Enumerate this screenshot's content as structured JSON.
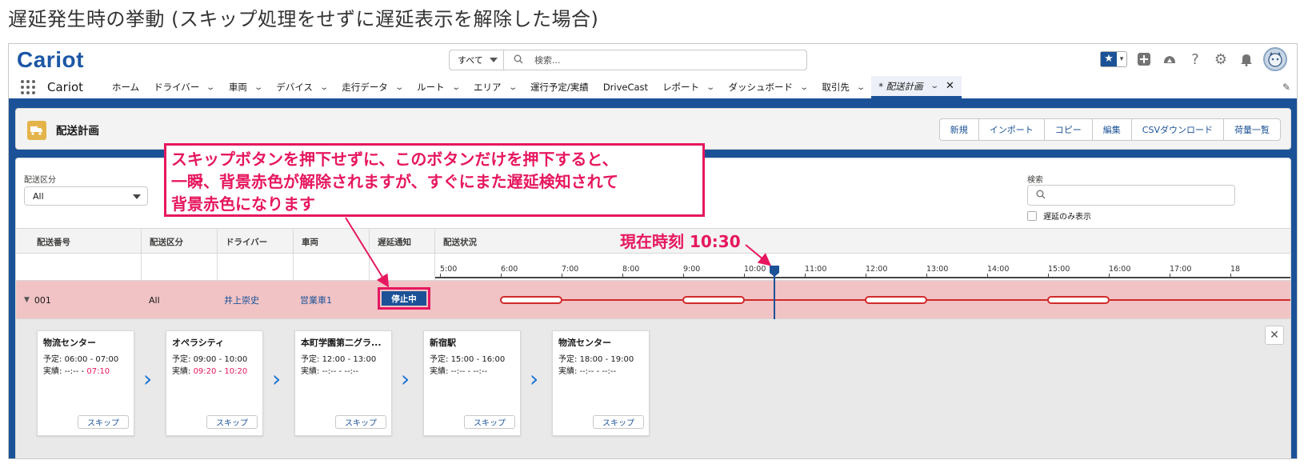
{
  "page_title": "遅延発生時の挙動 (スキップ処理をせずに遅延表示を解除した場合)",
  "header": {
    "logo": "Cariot",
    "search_scope": "すべて",
    "search_placeholder": "検索..."
  },
  "nav": {
    "app_name": "Cariot",
    "items": [
      {
        "label": "ホーム",
        "dropdown": false
      },
      {
        "label": "ドライバー",
        "dropdown": true
      },
      {
        "label": "車両",
        "dropdown": true
      },
      {
        "label": "デバイス",
        "dropdown": true
      },
      {
        "label": "走行データ",
        "dropdown": true
      },
      {
        "label": "ルート",
        "dropdown": true
      },
      {
        "label": "エリア",
        "dropdown": true
      },
      {
        "label": "運行予定/実績",
        "dropdown": false
      },
      {
        "label": "DriveCast",
        "dropdown": false
      },
      {
        "label": "レポート",
        "dropdown": true
      },
      {
        "label": "ダッシュボード",
        "dropdown": true
      },
      {
        "label": "取引先",
        "dropdown": true
      }
    ],
    "active_tab": "* 配送計画"
  },
  "object_header": {
    "title": "配送計画",
    "buttons": [
      "新規",
      "インポート",
      "コピー",
      "編集",
      "CSVダウンロード",
      "荷量一覧"
    ]
  },
  "filters": {
    "category_label": "配送区分",
    "category_value": "All",
    "search_label": "検索",
    "delayed_only_label": "遅延のみ表示"
  },
  "table": {
    "columns": [
      "配送番号",
      "配送区分",
      "ドライバー",
      "車両",
      "遅延通知",
      "配送状況"
    ],
    "timeline_hours": [
      "5:00",
      "6:00",
      "7:00",
      "8:00",
      "9:00",
      "10:00",
      "11:00",
      "12:00",
      "13:00",
      "14:00",
      "15:00",
      "16:00",
      "17:00",
      "18"
    ],
    "current_time_hour": 10.5,
    "route_segments": [
      [
        6.0,
        7.0
      ],
      [
        9.0,
        10.0
      ],
      [
        12.0,
        13.0
      ],
      [
        15.0,
        16.0
      ]
    ],
    "row": {
      "number": "001",
      "category": "All",
      "driver": "井上崇史",
      "vehicle": "営業車1",
      "notify_button": "停止中"
    }
  },
  "stops": [
    {
      "name": "物流センター",
      "plan_label": "予定:",
      "plan_start": "06:00",
      "plan_end": "07:00",
      "actual_label": "実績:",
      "actual_start": "--:--",
      "actual_end": "07:10",
      "start_red": false,
      "end_red": true,
      "skip": "スキップ"
    },
    {
      "name": "オペラシティ",
      "plan_label": "予定:",
      "plan_start": "09:00",
      "plan_end": "10:00",
      "actual_label": "実績:",
      "actual_start": "09:20",
      "actual_end": "10:20",
      "start_red": true,
      "end_red": true,
      "skip": "スキップ"
    },
    {
      "name": "本町学園第二グラ...",
      "plan_label": "予定:",
      "plan_start": "12:00",
      "plan_end": "13:00",
      "actual_label": "実績:",
      "actual_start": "--:--",
      "actual_end": "--:--",
      "start_red": false,
      "end_red": false,
      "skip": "スキップ"
    },
    {
      "name": "新宿駅",
      "plan_label": "予定:",
      "plan_start": "15:00",
      "plan_end": "16:00",
      "actual_label": "実績:",
      "actual_start": "--:--",
      "actual_end": "--:--",
      "start_red": false,
      "end_red": false,
      "skip": "スキップ"
    },
    {
      "name": "物流センター",
      "plan_label": "予定:",
      "plan_start": "18:00",
      "plan_end": "19:00",
      "actual_label": "実績:",
      "actual_start": "--:--",
      "actual_end": "--:--",
      "start_red": false,
      "end_red": false,
      "skip": "スキップ"
    }
  ],
  "annotations": {
    "callout_lines": [
      "スキップボタンを押下せずに、このボタンだけを押下すると、",
      "一瞬、背景赤色が解除されますが、すぐにまた遅延検知されて",
      "背景赤色になります"
    ],
    "current_time_label": "現在時刻 10:30"
  },
  "colors": {
    "brand": "#1b5297",
    "highlight": "#e6175f",
    "delay_row": "#f1c3c5",
    "route_line": "#d12a2a"
  }
}
